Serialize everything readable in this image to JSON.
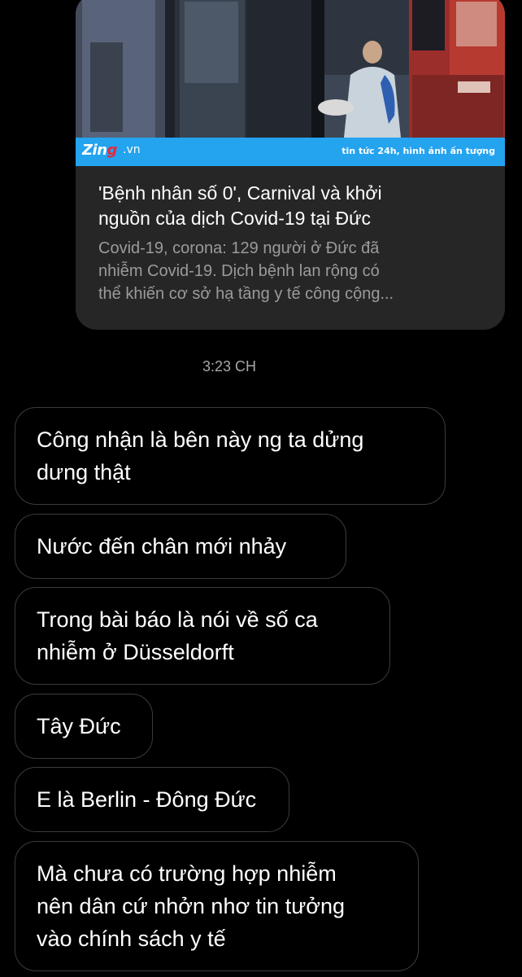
{
  "link_preview": {
    "brand_logo": "Zing",
    "brand_domain": ".vn",
    "brand_tagline": "tin tức 24h, hình ảnh ấn tượng",
    "title_lines": [
      "'Bệnh nhân số 0', Carnival và khởi",
      "nguồn của dịch Covid-19 tại Đức"
    ],
    "description_lines": [
      "Covid-19, corona: 129 người ở Đức đã",
      "nhiễm Covid-19. Dịch bệnh lan rộng có",
      "thể khiến cơ sở hạ tầng y tế công cộng..."
    ],
    "banner_color": "#24a3ef"
  },
  "timestamp": "3:23 CH",
  "messages": [
    {
      "lines": [
        "Công nhận là bên này ng ta dửng",
        "dưng thật"
      ]
    },
    {
      "lines": [
        "Nước đến chân mới nhảy"
      ]
    },
    {
      "lines": [
        "Trong bài báo là nói về số ca",
        "nhiễm ở Düsseldorft"
      ]
    },
    {
      "lines": [
        "Tây Đức"
      ]
    },
    {
      "lines": [
        "E là Berlin - Đông Đức"
      ]
    },
    {
      "lines": [
        "Mà chưa có trường hợp nhiễm",
        "nên dân cứ nhởn nhơ tin tưởng",
        "vào chính sách y tế"
      ]
    }
  ]
}
